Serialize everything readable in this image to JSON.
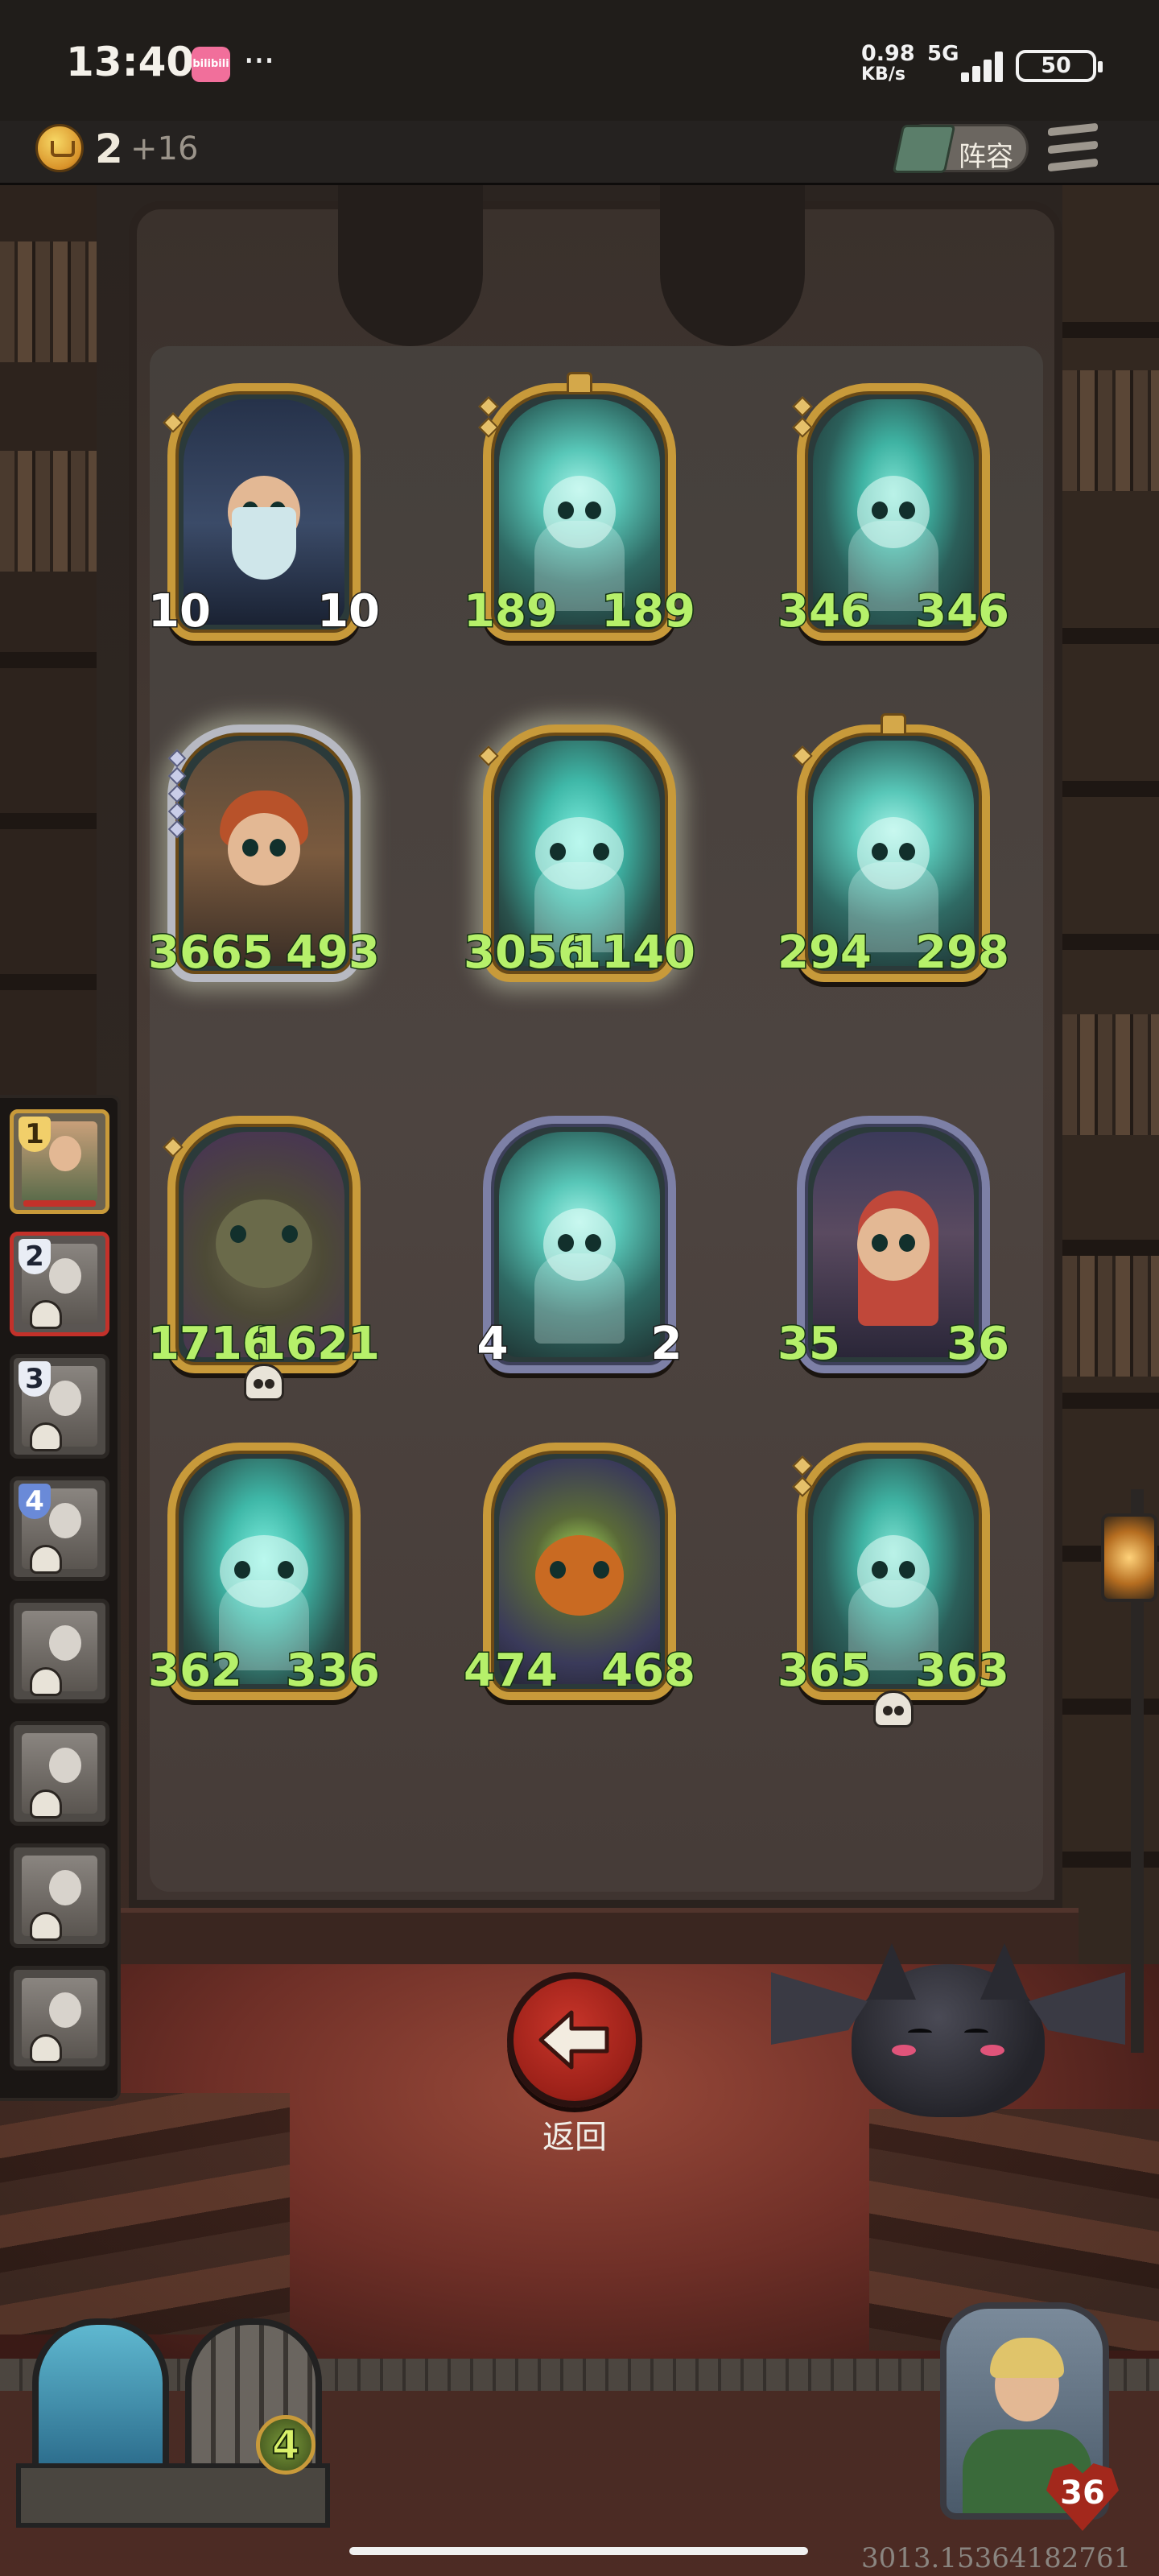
{
  "status_bar": {
    "time": "13:40",
    "app_badge": "bilibili",
    "more": "···",
    "net_speed_value": "0.98",
    "net_speed_unit": "KB/s",
    "network": "5G",
    "battery": "50"
  },
  "resources": {
    "gold": "2",
    "gold_income": "+16",
    "roster_label": "阵容"
  },
  "board": {
    "units": [
      {
        "art": "wizard",
        "frame": "gold",
        "attack": "10",
        "health": "10",
        "white_stats": true
      },
      {
        "art": "skull-ghost",
        "frame": "gold",
        "attack": "189",
        "health": "189"
      },
      {
        "art": "ghost",
        "frame": "gold",
        "attack": "346",
        "health": "346"
      },
      {
        "art": "archer",
        "frame": "gold",
        "attack": "3665",
        "health": "493"
      },
      {
        "art": "wolf-ghost",
        "frame": "gold",
        "attack": "3056",
        "health": "1140"
      },
      {
        "art": "skull-ghost",
        "frame": "gold",
        "attack": "294",
        "health": "298"
      },
      {
        "art": "rock-golem",
        "frame": "gold",
        "attack": "1716",
        "health": "1621"
      },
      {
        "art": "skull-ghost",
        "frame": "silver",
        "attack": "4",
        "health": "2",
        "white_stats": true
      },
      {
        "art": "witch",
        "frame": "silver",
        "attack": "35",
        "health": "36"
      },
      {
        "art": "wolf-ghost",
        "frame": "gold",
        "attack": "362",
        "health": "336"
      },
      {
        "art": "pumpkin-knight",
        "frame": "gold",
        "attack": "474",
        "health": "468"
      },
      {
        "art": "ghost",
        "frame": "gold",
        "attack": "365",
        "health": "363"
      }
    ]
  },
  "rounds": {
    "items": [
      {
        "number": "1",
        "state": "current"
      },
      {
        "number": "2",
        "state": "selected"
      },
      {
        "number": "3",
        "state": "lost"
      },
      {
        "number": "4",
        "state": "lost"
      },
      {
        "number": "",
        "state": "lost"
      },
      {
        "number": "",
        "state": "lost"
      },
      {
        "number": "",
        "state": "lost"
      },
      {
        "number": "",
        "state": "lost"
      }
    ]
  },
  "back_button": {
    "label": "返回",
    "icon": "arrow-left-icon"
  },
  "bottom_hud": {
    "tower_count": "4",
    "hero_health": "36"
  },
  "watermark": "3013.15364182761",
  "colors": {
    "stat_green": "#b6f06a",
    "gold_frame": "#c89a3a",
    "silver_frame": "#7d80a6",
    "back_red": "#c9352a"
  }
}
